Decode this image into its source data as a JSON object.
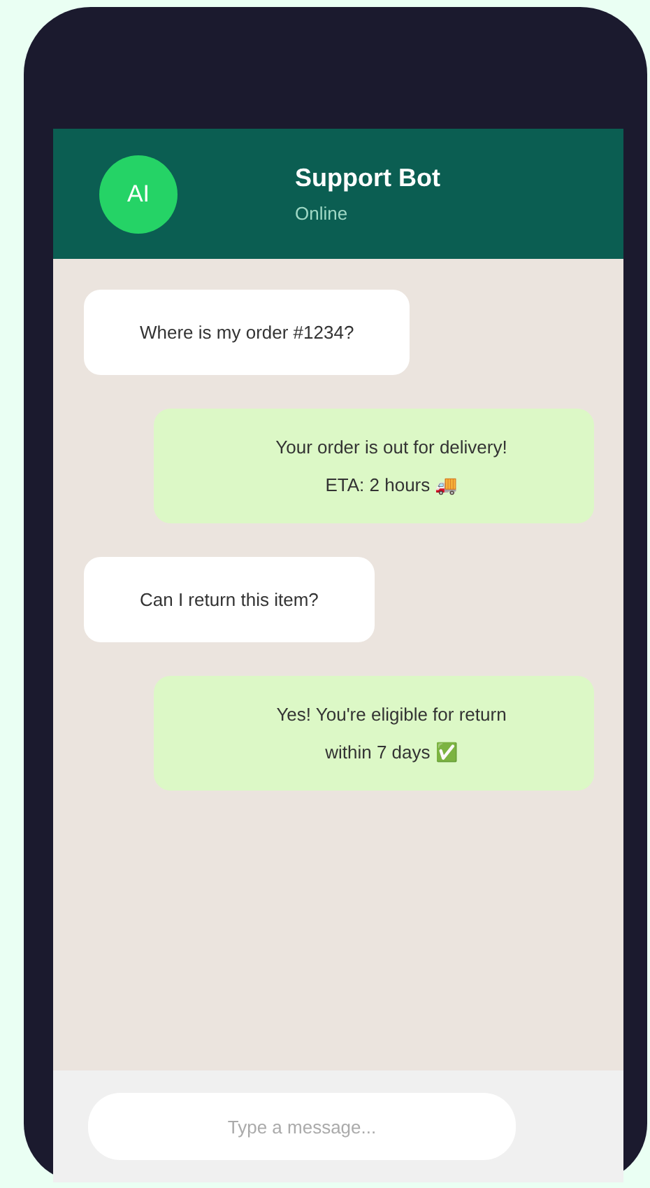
{
  "header": {
    "avatar": "AI",
    "title": "Support Bot",
    "status": "Online"
  },
  "messages": [
    {
      "text": "Where is my order #1234?",
      "kind": "incoming"
    },
    {
      "text": "Your order is out for delivery! ETA: 2 hours 🚚",
      "kind": "outgoing"
    },
    {
      "text": "Can I return this item?",
      "kind": "incoming"
    },
    {
      "text": "Yes! You're eligible for return within 7 days ✅",
      "kind": "outgoing"
    }
  ],
  "composer": {
    "placeholder": "Type a message..."
  }
}
